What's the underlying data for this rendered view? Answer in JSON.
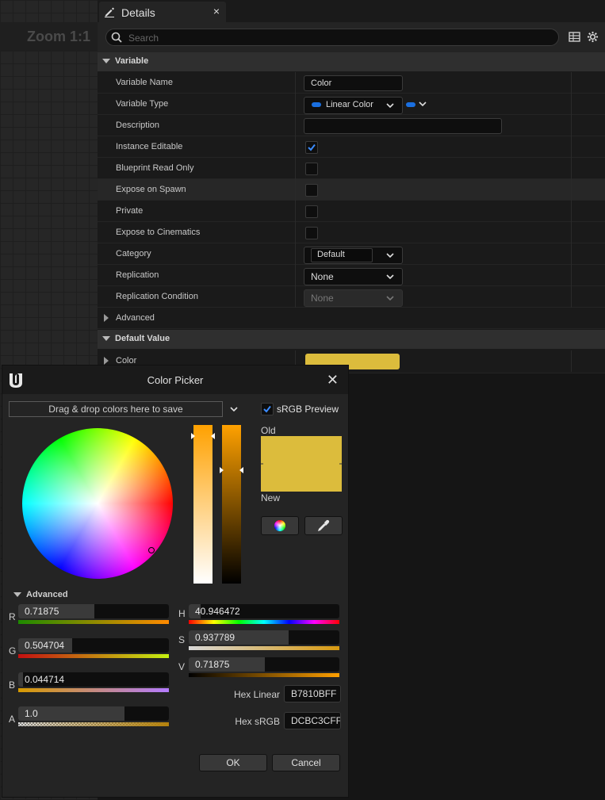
{
  "graph": {
    "zoom_label": "Zoom 1:1"
  },
  "details": {
    "tab_title": "Details",
    "close_glyph": "×",
    "search_placeholder": "Search",
    "sections": {
      "variable": "Variable",
      "default_value": "Default Value"
    },
    "rows": {
      "variable_name": {
        "label": "Variable Name",
        "value": "Color"
      },
      "variable_type": {
        "label": "Variable Type",
        "value": "Linear Color",
        "pin_color": "#1a6fe0"
      },
      "description": {
        "label": "Description",
        "value": ""
      },
      "instance_editable": {
        "label": "Instance Editable",
        "checked": true
      },
      "blueprint_read_only": {
        "label": "Blueprint Read Only",
        "checked": false
      },
      "expose_on_spawn": {
        "label": "Expose on Spawn",
        "checked": false
      },
      "private": {
        "label": "Private",
        "checked": false
      },
      "expose_to_cinematics": {
        "label": "Expose to Cinematics",
        "checked": false
      },
      "category": {
        "label": "Category",
        "value": "Default"
      },
      "replication": {
        "label": "Replication",
        "value": "None"
      },
      "replication_condition": {
        "label": "Replication Condition",
        "value": "None"
      },
      "advanced": {
        "label": "Advanced"
      },
      "color": {
        "label": "Color",
        "swatch": "#DCBC3C"
      }
    }
  },
  "picker": {
    "title": "Color Picker",
    "close_glyph": "✕",
    "swatch_bar": "Drag & drop colors here to save",
    "srgb_preview": {
      "label": "sRGB Preview",
      "checked": true
    },
    "old_label": "Old",
    "new_label": "New",
    "old_color": "#DCBC3C",
    "new_color": "#DCBC3C",
    "advanced_label": "Advanced",
    "channels": {
      "r": {
        "label": "R",
        "value": "0.71875",
        "fraction": 0.71875
      },
      "g": {
        "label": "G",
        "value": "0.504704",
        "fraction": 0.504704
      },
      "b": {
        "label": "B",
        "value": "0.044714",
        "fraction": 0.044714
      },
      "a": {
        "label": "A",
        "value": "1.0",
        "fraction": 1.0
      },
      "h": {
        "label": "H",
        "value": "40.946472",
        "fraction": 0.1137
      },
      "s": {
        "label": "S",
        "value": "0.937789",
        "fraction": 0.937789
      },
      "v": {
        "label": "V",
        "value": "0.71875",
        "fraction": 0.71875
      }
    },
    "hex_linear": {
      "label": "Hex Linear",
      "value": "B7810BFF"
    },
    "hex_srgb": {
      "label": "Hex sRGB",
      "value": "DCBC3CFF"
    },
    "ok_label": "OK",
    "cancel_label": "Cancel"
  },
  "colors": {
    "accent": "#1a6fe0",
    "check": "#3b8cff"
  }
}
